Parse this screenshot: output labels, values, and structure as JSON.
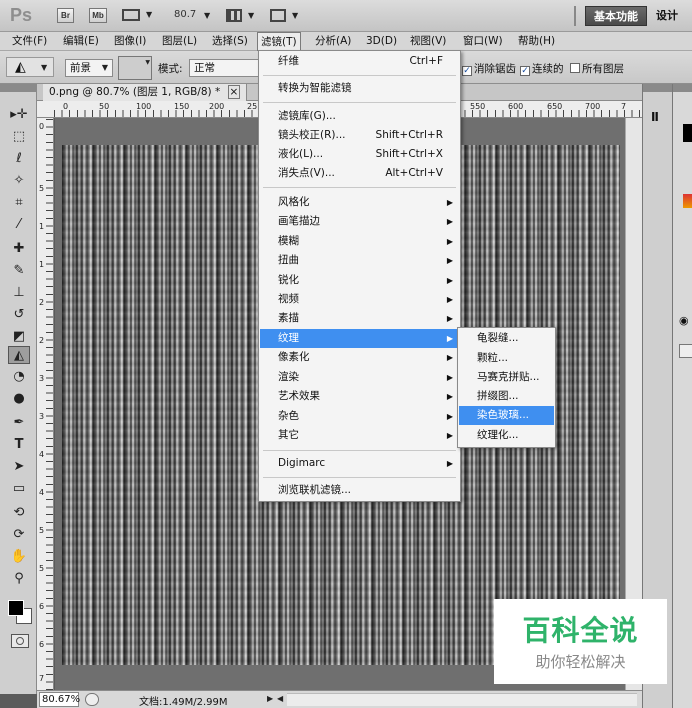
{
  "app": {
    "logo": "Ps",
    "buttons": [
      "Br",
      "Mb"
    ],
    "zoom": "80.7",
    "workspace": "基本功能",
    "design": "设计"
  },
  "menubar": [
    "文件(F)",
    "编辑(E)",
    "图像(I)",
    "图层(L)",
    "选择(S)",
    "滤镜(T)",
    "分析(A)",
    "3D(D)",
    "视图(V)",
    "窗口(W)",
    "帮助(H)"
  ],
  "options": {
    "foreground": "前景",
    "mode_label": "模式:",
    "mode_value": "正常",
    "antialias": "消除锯齿",
    "contiguous": "连续的",
    "all_layers": "所有图层"
  },
  "document": {
    "title": "0.png @ 80.7% (图层 1, RGB/8) *",
    "close": "×",
    "ruler_h": [
      "0",
      "50",
      "100",
      "150",
      "200",
      "25",
      "550",
      "600",
      "650",
      "700",
      "7"
    ],
    "ruler_v": [
      "0",
      "5",
      "1",
      "1",
      "2",
      "2",
      "3",
      "3",
      "4",
      "4",
      "5",
      "5",
      "6",
      "6",
      "7"
    ]
  },
  "status": {
    "zoom": "80.67%",
    "doc": "文档:1.49M/2.99M"
  },
  "filter_menu": {
    "items": [
      {
        "label": "纤维",
        "shortcut": "Ctrl+F"
      },
      {
        "label": "转换为智能滤镜"
      },
      {
        "label": "滤镜库(G)..."
      },
      {
        "label": "镜头校正(R)...",
        "shortcut": "Shift+Ctrl+R"
      },
      {
        "label": "液化(L)...",
        "shortcut": "Shift+Ctrl+X"
      },
      {
        "label": "消失点(V)...",
        "shortcut": "Alt+Ctrl+V"
      },
      {
        "label": "风格化"
      },
      {
        "label": "画笔描边"
      },
      {
        "label": "模糊"
      },
      {
        "label": "扭曲"
      },
      {
        "label": "锐化"
      },
      {
        "label": "视频"
      },
      {
        "label": "素描"
      },
      {
        "label": "纹理"
      },
      {
        "label": "像素化"
      },
      {
        "label": "渲染"
      },
      {
        "label": "艺术效果"
      },
      {
        "label": "杂色"
      },
      {
        "label": "其它"
      },
      {
        "label": "Digimarc"
      },
      {
        "label": "浏览联机滤镜..."
      }
    ]
  },
  "texture_submenu": [
    "龟裂缝...",
    "颗粒...",
    "马赛克拼贴...",
    "拼缀图...",
    "染色玻璃...",
    "纹理化..."
  ],
  "watermark": {
    "title": "百科全说",
    "subtitle": "助你轻松解决"
  }
}
